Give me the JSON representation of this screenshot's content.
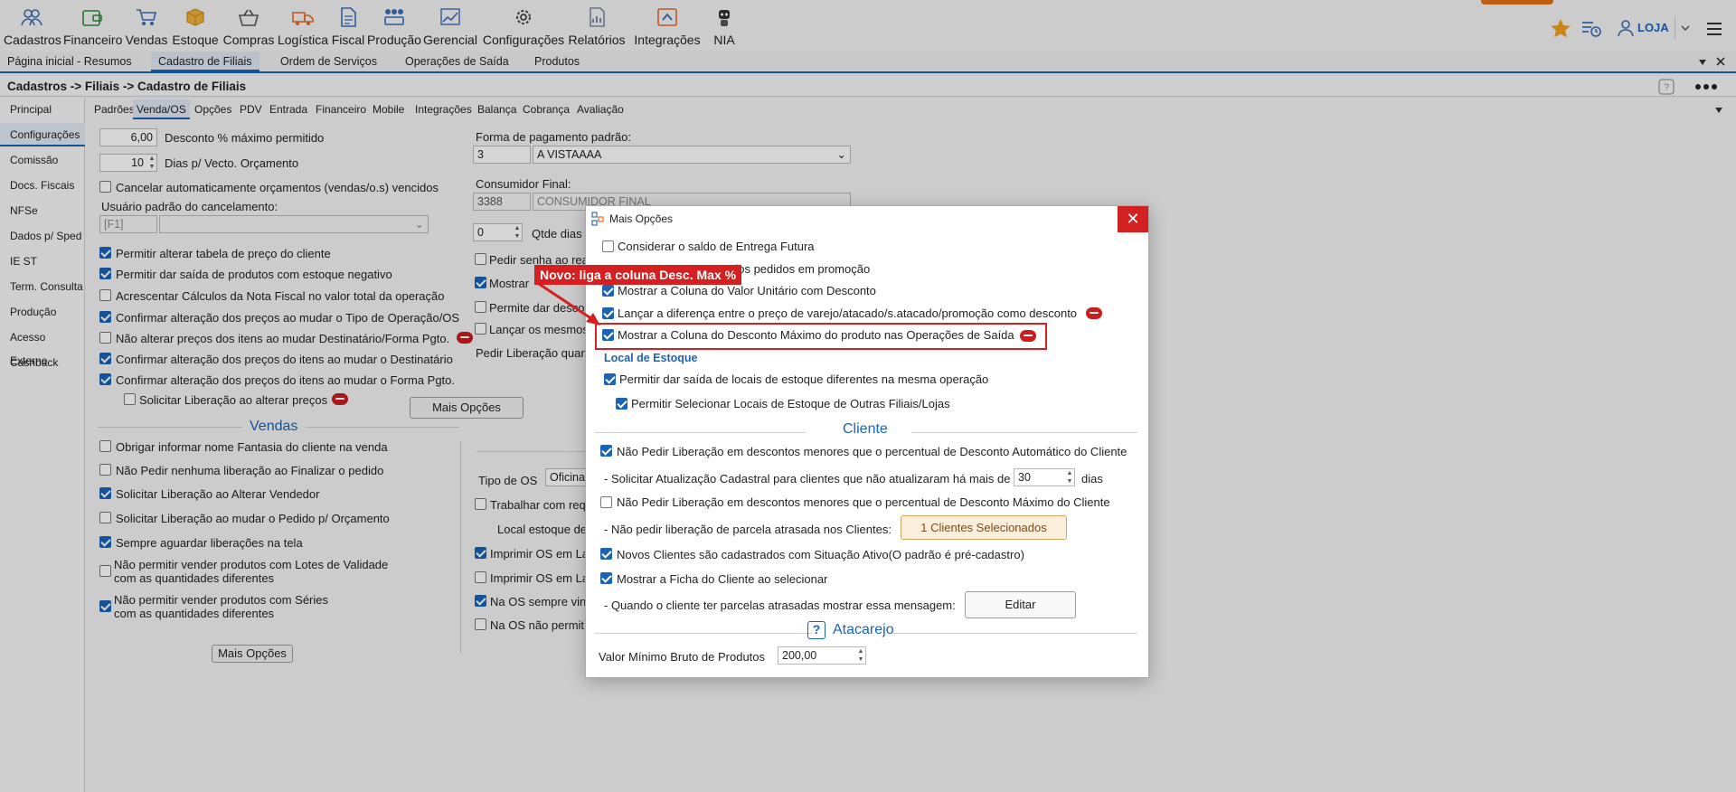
{
  "ribbon": {
    "items": [
      "Cadastros",
      "Financeiro",
      "Vendas",
      "Estoque",
      "Compras",
      "Logística",
      "Fiscal",
      "Produção",
      "Gerencial",
      "Configurações",
      "Relatórios",
      "Integrações",
      "NIA"
    ],
    "user": "LOJA"
  },
  "tabs": [
    "Página inicial - Resumos",
    "Cadastro de Filiais",
    "Ordem de Serviços",
    "Operações de Saída",
    "Produtos"
  ],
  "breadcrumb": "Cadastros -> Filiais -> Cadastro de Filiais",
  "leftnav": [
    "Principal",
    "Configurações",
    "Comissão",
    "Docs. Fiscais",
    "NFSe",
    "Dados p/ Sped",
    "IE ST",
    "Term. Consulta",
    "Produção",
    "Acesso Externo",
    "Cashback"
  ],
  "subtabs": [
    "Padrões",
    "Venda/OS",
    "Opções",
    "PDV",
    "Entrada",
    "Financeiro",
    "Mobile",
    "Integrações",
    "Balança",
    "Cobrança",
    "Avaliação"
  ],
  "left_form": {
    "desconto_value": "6,00",
    "desconto_label": "Desconto % máximo permitido",
    "dias_value": "10",
    "dias_label": "Dias p/ Vecto. Orçamento",
    "cancelar_label": "Cancelar automaticamente orçamentos (vendas/o.s) vencidos",
    "usuario_label": "Usuário padrão do cancelamento:",
    "usuario_code": "[F1]",
    "checks": [
      "Permitir alterar tabela de preço do cliente",
      "Permitir dar saída de produtos com estoque negativo",
      "Acrescentar Cálculos da Nota Fiscal no valor total da operação",
      "Confirmar alteração dos preços ao mudar o Tipo de Operação/OS",
      "Não alterar preços dos itens ao mudar Destinatário/Forma Pgto.",
      "Confirmar alteração dos preços do itens ao mudar o Destinatário",
      "Confirmar alteração dos preços do itens ao mudar o Forma Pgto.",
      "Solicitar Liberação ao alterar preços"
    ],
    "vendas_title": "Vendas",
    "vendas_checks": [
      "Obrigar informar nome Fantasia do cliente na venda",
      "Não Pedir nenhuma liberação ao Finalizar o pedido",
      "Solicitar Liberação ao Alterar Vendedor",
      "Solicitar Liberação ao mudar o Pedido p/ Orçamento",
      "Sempre aguardar liberações na tela"
    ],
    "lotes_1": "Não permitir vender produtos com Lotes de Validade",
    "lotes_2": "com as quantidades diferentes",
    "series_1": "Não permitir vender produtos com Séries",
    "series_2": "com as quantidades diferentes",
    "mais_opcoes": "Mais Opções"
  },
  "mid_form": {
    "forma_label": "Forma de pagamento padrão:",
    "forma_code": "3",
    "forma_value": "A VISTAAAA",
    "consumidor_label": "Consumidor Final:",
    "consumidor_code": "3388",
    "consumidor_value": "CONSUMIDOR FINAL",
    "qtde_value": "0",
    "qtde_label": "Qtde dias",
    "c1": "Pedir senha ao rea",
    "c2": "Mostrar",
    "c3": "Permite dar desco",
    "c4": "Lançar os mesmos",
    "pedir_lib": "Pedir Liberação quan",
    "mais_opcoes": "Mais Opções",
    "tipo_os_label": "Tipo de OS",
    "tipo_os_value": "Oficina",
    "trabalhar": "Trabalhar com req",
    "local_estoque": "Local estoque de",
    "imprimir1": "Imprimir OS em La",
    "imprimir2": "Imprimir OS em La",
    "na_os1": "Na OS sempre vin",
    "na_os2": "Na OS não permit"
  },
  "dialog": {
    "title": "Mais Opções",
    "close": "✕",
    "rows": [
      "Considerar o saldo de Entrega Futura",
      "dos pedidos em promoção",
      "Mostrar a Coluna do Valor Unitário com Desconto",
      "Lançar a diferença entre o preço de varejo/atacado/s.atacado/promoção como desconto",
      "Mostrar a Coluna do Desconto Máximo do produto nas Operações de Saída"
    ],
    "local_estoque_title": "Local de Estoque",
    "local1": "Permitir dar saída de locais de estoque diferentes na mesma operação",
    "local2": "Permitir Selecionar Locais de Estoque de Outras Filiais/Lojas",
    "cliente_title": "Cliente",
    "cli1": "Não Pedir Liberação em descontos menores que o percentual de Desconto Automático do Cliente",
    "cli_atual_prefix": "- Solicitar Atualização Cadastral para clientes que não atualizaram há mais de",
    "cli_atual_value": "30",
    "cli_atual_suffix": "dias",
    "cli2": "Não Pedir Liberação em descontos menores que o percentual de Desconto Máximo do Cliente",
    "cli_parcela": "- Não pedir liberação de parcela atrasada nos Clientes:",
    "cli_parcela_btn": "1 Clientes Selecionados",
    "cli3": "Novos Clientes são cadastrados com Situação Ativo(O padrão é pré-cadastro)",
    "cli4": "Mostrar a Ficha do Cliente ao selecionar",
    "cli_msg": "- Quando o cliente ter parcelas atrasadas mostrar essa mensagem:",
    "cli_msg_btn": "Editar",
    "atacarejo_title": "Atacarejo",
    "atacarejo_help": "?",
    "valor_min_label": "Valor Mínimo Bruto de Produtos",
    "valor_min_value": "200,00"
  },
  "callout": "Novo: liga a coluna Desc. Max %",
  "colors": {
    "accent": "#1a63b5",
    "callout": "#d42020"
  }
}
